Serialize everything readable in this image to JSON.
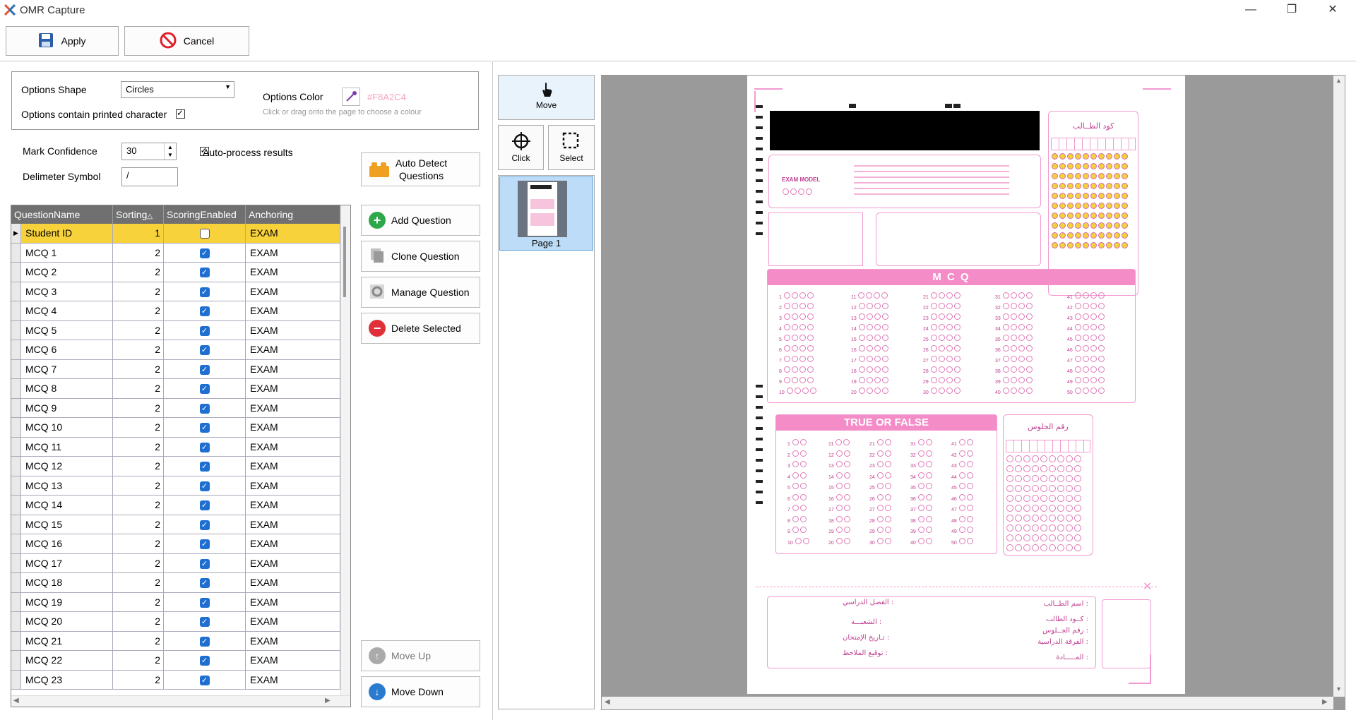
{
  "window": {
    "title": "OMR Capture"
  },
  "toolbar": {
    "apply_label": "Apply",
    "cancel_label": "Cancel"
  },
  "options": {
    "shape_label": "Options Shape",
    "shape_value": "Circles",
    "printed_char_label": "Options contain printed character",
    "printed_char_checked": true,
    "color_label": "Options Color",
    "color_value": "#F8A2C4",
    "color_hint": "Click or drag onto the page to choose a colour"
  },
  "settings": {
    "confidence_label": "Mark Confidence",
    "confidence_value": "30",
    "auto_process_label": "Auto-process results",
    "auto_process_checked": true,
    "delimiter_label": "Delimeter Symbol",
    "delimiter_value": "/"
  },
  "actions": {
    "auto_detect": "Auto Detect\nQuestions",
    "add": "Add Question",
    "clone": "Clone Question",
    "manage": "Manage Question",
    "delete": "Delete Selected",
    "move_up": "Move Up",
    "move_down": "Move Down"
  },
  "grid": {
    "columns": [
      "QuestionName",
      "Sorting",
      "ScoringEnabled",
      "Anchoring"
    ],
    "rows": [
      {
        "name": "Student ID",
        "sorting": "1",
        "scoring": false,
        "anchoring": "EXAM"
      },
      {
        "name": "MCQ 1",
        "sorting": "2",
        "scoring": true,
        "anchoring": "EXAM"
      },
      {
        "name": "MCQ 2",
        "sorting": "2",
        "scoring": true,
        "anchoring": "EXAM"
      },
      {
        "name": "MCQ 3",
        "sorting": "2",
        "scoring": true,
        "anchoring": "EXAM"
      },
      {
        "name": "MCQ 4",
        "sorting": "2",
        "scoring": true,
        "anchoring": "EXAM"
      },
      {
        "name": "MCQ 5",
        "sorting": "2",
        "scoring": true,
        "anchoring": "EXAM"
      },
      {
        "name": "MCQ 6",
        "sorting": "2",
        "scoring": true,
        "anchoring": "EXAM"
      },
      {
        "name": "MCQ 7",
        "sorting": "2",
        "scoring": true,
        "anchoring": "EXAM"
      },
      {
        "name": "MCQ 8",
        "sorting": "2",
        "scoring": true,
        "anchoring": "EXAM"
      },
      {
        "name": "MCQ 9",
        "sorting": "2",
        "scoring": true,
        "anchoring": "EXAM"
      },
      {
        "name": "MCQ 10",
        "sorting": "2",
        "scoring": true,
        "anchoring": "EXAM"
      },
      {
        "name": "MCQ 11",
        "sorting": "2",
        "scoring": true,
        "anchoring": "EXAM"
      },
      {
        "name": "MCQ 12",
        "sorting": "2",
        "scoring": true,
        "anchoring": "EXAM"
      },
      {
        "name": "MCQ 13",
        "sorting": "2",
        "scoring": true,
        "anchoring": "EXAM"
      },
      {
        "name": "MCQ 14",
        "sorting": "2",
        "scoring": true,
        "anchoring": "EXAM"
      },
      {
        "name": "MCQ 15",
        "sorting": "2",
        "scoring": true,
        "anchoring": "EXAM"
      },
      {
        "name": "MCQ 16",
        "sorting": "2",
        "scoring": true,
        "anchoring": "EXAM"
      },
      {
        "name": "MCQ 17",
        "sorting": "2",
        "scoring": true,
        "anchoring": "EXAM"
      },
      {
        "name": "MCQ 18",
        "sorting": "2",
        "scoring": true,
        "anchoring": "EXAM"
      },
      {
        "name": "MCQ 19",
        "sorting": "2",
        "scoring": true,
        "anchoring": "EXAM"
      },
      {
        "name": "MCQ 20",
        "sorting": "2",
        "scoring": true,
        "anchoring": "EXAM"
      },
      {
        "name": "MCQ 21",
        "sorting": "2",
        "scoring": true,
        "anchoring": "EXAM"
      },
      {
        "name": "MCQ 22",
        "sorting": "2",
        "scoring": true,
        "anchoring": "EXAM"
      },
      {
        "name": "MCQ 23",
        "sorting": "2",
        "scoring": true,
        "anchoring": "EXAM"
      }
    ]
  },
  "tools": {
    "move": "Move",
    "click": "Click",
    "select": "Select",
    "page_label": "Page 1"
  },
  "sheet": {
    "student_code": "كود الطــالب",
    "exam_model": "EXAM MODEL",
    "mcq_title": "M C Q",
    "tf_title": "TRUE OR FALSE",
    "seat_number": "رقم الجلوس",
    "f_name": "اسم الطــالب :",
    "f_code": "كــود الطالب :",
    "f_seat": "رقم الجــلوس :",
    "f_grade": "الفرقة الدراسية :",
    "f_subject": "المـــــادة :",
    "f_term": "الفصل الدراسي :",
    "f_division": "الشعبـــة :",
    "f_date": "تـاريخ الإمتحان :",
    "f_sign": "توقيع الملاحظ :"
  },
  "colors": {
    "accent": "#F8A2C4",
    "selected_row": "#f8d23b",
    "check_blue": "#1f6fd1"
  }
}
